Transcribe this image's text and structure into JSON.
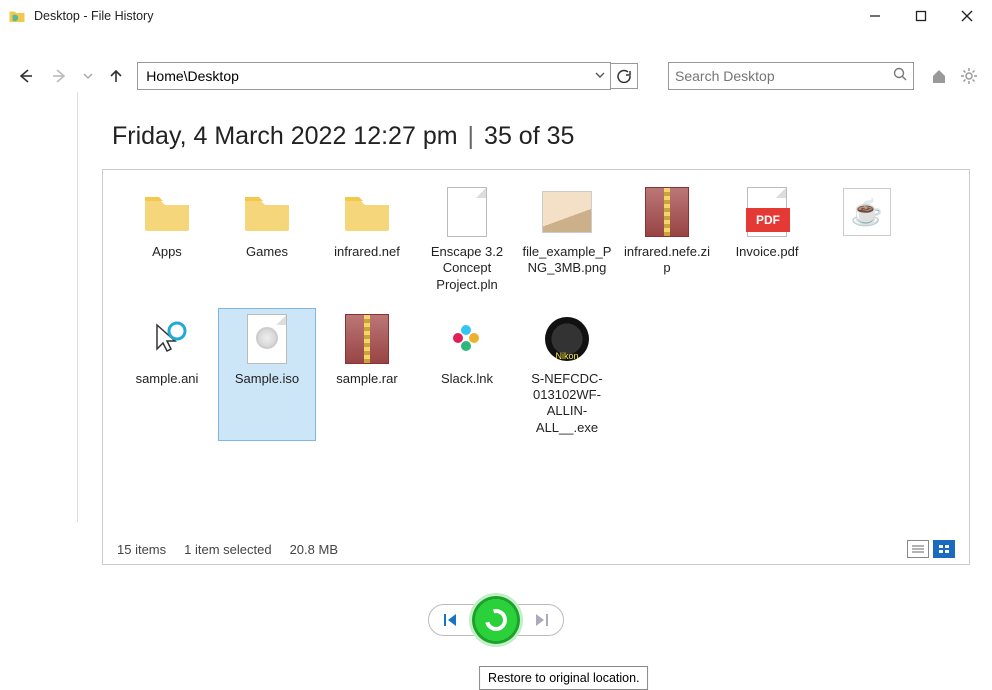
{
  "window": {
    "title": "Desktop - File History"
  },
  "toolbar": {
    "address": "Home\\Desktop",
    "search_placeholder": "Search Desktop"
  },
  "header": {
    "timestamp": "Friday, 4 March 2022 12:27 pm",
    "position": "35 of 35"
  },
  "items": [
    {
      "label": "Apps",
      "icon": "folder"
    },
    {
      "label": "Games",
      "icon": "folder"
    },
    {
      "label": "infrared.nef",
      "icon": "folder"
    },
    {
      "label": "Enscape 3.2 Concept Project.pln",
      "icon": "file"
    },
    {
      "label": "file_example_PNG_3MB.png",
      "icon": "png"
    },
    {
      "label": "infrared.nefe.zip",
      "icon": "zip"
    },
    {
      "label": "Invoice.pdf",
      "icon": "pdf"
    },
    {
      "label": "",
      "icon": "java"
    },
    {
      "label": "sample.ani",
      "icon": "cursor"
    },
    {
      "label": "Sample.iso",
      "icon": "iso",
      "selected": true
    },
    {
      "label": "sample.rar",
      "icon": "zip"
    },
    {
      "label": "Slack.lnk",
      "icon": "slack"
    },
    {
      "label": "S-NEFCDC-013102WF-ALLIN-ALL__.exe",
      "icon": "nikon"
    }
  ],
  "status": {
    "count": "15 items",
    "selection": "1 item selected",
    "size": "20.8 MB"
  },
  "restore": {
    "tooltip": "Restore to original location."
  }
}
